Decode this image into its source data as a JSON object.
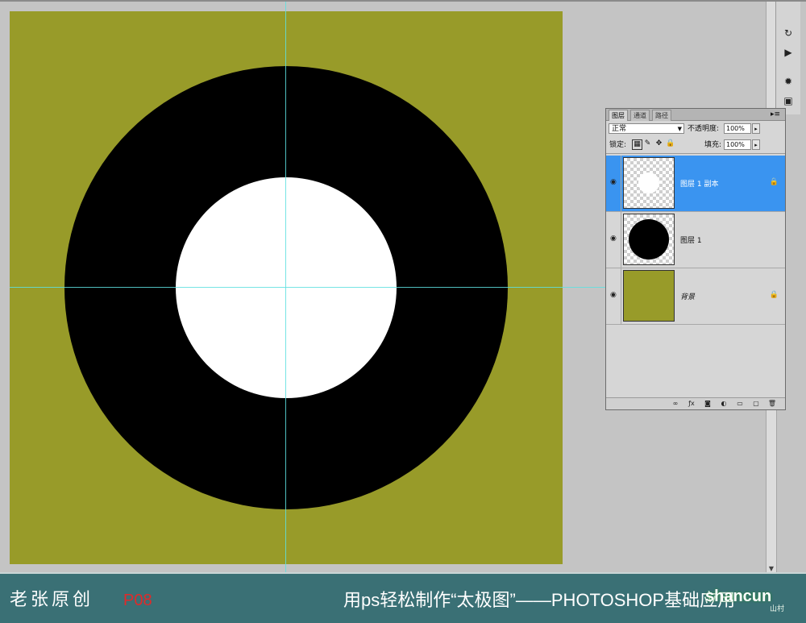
{
  "canvas": {
    "background_color": "#989b29",
    "outer_circle_color": "#000000",
    "inner_circle_color": "#ffffff",
    "guide_color": "#5ee0e0"
  },
  "tools": [
    "history-icon",
    "actions-icon",
    "brightness-icon",
    "image-icon"
  ],
  "layers_panel": {
    "tabs": [
      "图层",
      "通道",
      "路径"
    ],
    "menu_icon": "panel-menu-icon",
    "blend_mode": "正常",
    "opacity_label": "不透明度:",
    "opacity_value": "100%",
    "lock_label": "锁定:",
    "fill_label": "填充:",
    "fill_value": "100%",
    "layers": [
      {
        "name": "图层 1 副本",
        "selected": true,
        "thumb": "white-circle",
        "locked": true
      },
      {
        "name": "图层 1",
        "selected": false,
        "thumb": "black-circle",
        "locked": false
      },
      {
        "name": "背景",
        "selected": false,
        "thumb": "olive-fill",
        "locked": true
      }
    ],
    "selected_color": "#3a94f0"
  },
  "caption": {
    "author": "老张原创",
    "page": "P08",
    "title": "用ps轻松制作“太极图”——PHOTOSHOP基础应用",
    "bar_color": "#3a7075",
    "page_color": "#e02a2a"
  },
  "watermark": {
    "main": "shancun",
    "sub": "山村"
  }
}
